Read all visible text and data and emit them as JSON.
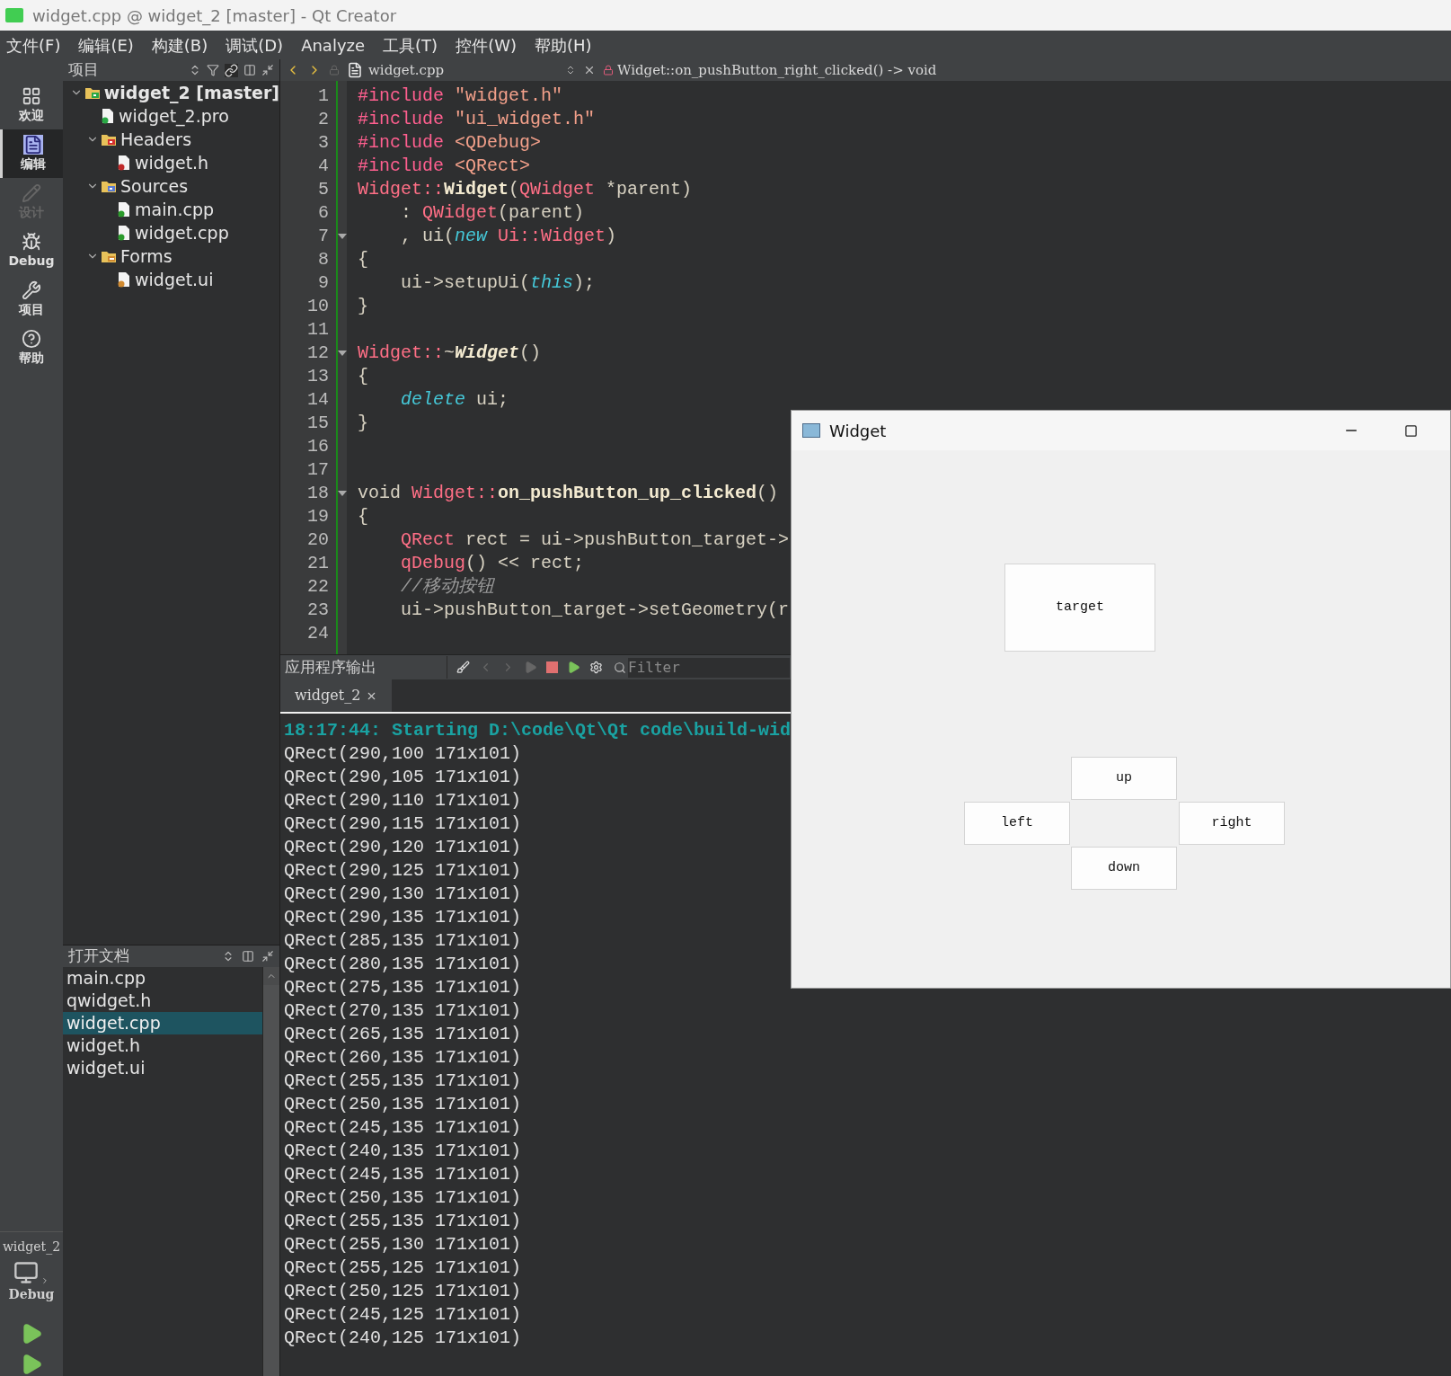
{
  "window": {
    "title": "widget.cpp @ widget_2 [master] - Qt Creator"
  },
  "menu": [
    {
      "label": "文件(F)"
    },
    {
      "label": "编辑(E)"
    },
    {
      "label": "构建(B)"
    },
    {
      "label": "调试(D)"
    },
    {
      "label": "Analyze"
    },
    {
      "label": "工具(T)"
    },
    {
      "label": "控件(W)"
    },
    {
      "label": "帮助(H)"
    }
  ],
  "mode_bar": [
    {
      "kind": "grid",
      "label": "欢迎",
      "selected": false,
      "disabled": false
    },
    {
      "kind": "doc",
      "label": "编辑",
      "selected": true,
      "disabled": false
    },
    {
      "kind": "pencil",
      "label": "设计",
      "selected": false,
      "disabled": true
    },
    {
      "kind": "bug",
      "label": "Debug",
      "selected": false,
      "disabled": false
    },
    {
      "kind": "wrench",
      "label": "项目",
      "selected": false,
      "disabled": false
    },
    {
      "kind": "help",
      "label": "帮助",
      "selected": false,
      "disabled": false
    }
  ],
  "kit": {
    "project": "widget_2",
    "build": "Debug"
  },
  "project_pane": {
    "title": "项目",
    "tree": [
      {
        "kind": "project",
        "label": "widget_2 [master]",
        "expanded": true,
        "children": [
          {
            "kind": "pro",
            "label": "widget_2.pro"
          },
          {
            "kind": "folder-h",
            "label": "Headers",
            "expanded": true,
            "children": [
              {
                "kind": "file-h",
                "label": "widget.h"
              }
            ]
          },
          {
            "kind": "folder-src",
            "label": "Sources",
            "expanded": true,
            "children": [
              {
                "kind": "file-cpp",
                "label": "main.cpp"
              },
              {
                "kind": "file-cpp",
                "label": "widget.cpp"
              }
            ]
          },
          {
            "kind": "folder-forms",
            "label": "Forms",
            "expanded": true,
            "children": [
              {
                "kind": "file-ui",
                "label": "widget.ui"
              }
            ]
          }
        ]
      }
    ]
  },
  "open_documents": {
    "title": "打开文档",
    "items": [
      {
        "label": "main.cpp",
        "selected": false
      },
      {
        "label": "qwidget.h",
        "selected": false
      },
      {
        "label": "widget.cpp",
        "selected": true
      },
      {
        "label": "widget.h",
        "selected": false
      },
      {
        "label": "widget.ui",
        "selected": false
      }
    ]
  },
  "editor": {
    "file": "widget.cpp",
    "symbol": "Widget::on_pushButton_right_clicked() -> void",
    "lines": [
      {
        "number": "1",
        "foldable": false,
        "tokens": [
          {
            "kind": "pp",
            "text": "#include"
          },
          {
            "kind": "str",
            "text": " \"widget.h\""
          }
        ]
      },
      {
        "number": "2",
        "foldable": false,
        "tokens": [
          {
            "kind": "pp",
            "text": "#include"
          },
          {
            "kind": "str",
            "text": " \"ui_widget.h\""
          }
        ]
      },
      {
        "number": "3",
        "foldable": false,
        "tokens": [
          {
            "kind": "pp",
            "text": "#include"
          },
          {
            "kind": "str",
            "text": " <QDebug>"
          }
        ]
      },
      {
        "number": "4",
        "foldable": false,
        "tokens": [
          {
            "kind": "pp",
            "text": "#include"
          },
          {
            "kind": "str",
            "text": " <QRect>"
          }
        ]
      },
      {
        "number": "5",
        "foldable": false,
        "tokens": [
          {
            "kind": "type",
            "text": "Widget::"
          },
          {
            "kind": "func",
            "text": "Widget"
          },
          {
            "kind": "plain",
            "text": "("
          },
          {
            "kind": "type",
            "text": "QWidget"
          },
          {
            "kind": "plain",
            "text": " *parent)"
          }
        ]
      },
      {
        "number": "6",
        "foldable": false,
        "tokens": [
          {
            "kind": "plain",
            "text": "    : "
          },
          {
            "kind": "type",
            "text": "QWidget"
          },
          {
            "kind": "plain",
            "text": "(parent)"
          }
        ]
      },
      {
        "number": "7",
        "foldable": true,
        "tokens": [
          {
            "kind": "plain",
            "text": "    , ui("
          },
          {
            "kind": "kw",
            "text": "new"
          },
          {
            "kind": "type",
            "text": " Ui::Widget"
          },
          {
            "kind": "plain",
            "text": ")"
          }
        ]
      },
      {
        "number": "8",
        "foldable": false,
        "tokens": [
          {
            "kind": "plain",
            "text": "{"
          }
        ]
      },
      {
        "number": "9",
        "foldable": false,
        "tokens": [
          {
            "kind": "plain",
            "text": "    ui->setupUi("
          },
          {
            "kind": "kw",
            "text": "this"
          },
          {
            "kind": "plain",
            "text": ");"
          }
        ]
      },
      {
        "number": "10",
        "foldable": false,
        "tokens": [
          {
            "kind": "plain",
            "text": "}"
          }
        ]
      },
      {
        "number": "11",
        "foldable": false
      },
      {
        "number": "12",
        "foldable": true,
        "tokens": [
          {
            "kind": "type",
            "text": "Widget::"
          },
          {
            "kind": "plain",
            "text": "~"
          },
          {
            "kind": "funcital",
            "text": "Widget"
          },
          {
            "kind": "plain",
            "text": "()"
          }
        ]
      },
      {
        "number": "13",
        "foldable": false,
        "tokens": [
          {
            "kind": "plain",
            "text": "{"
          }
        ]
      },
      {
        "number": "14",
        "foldable": false,
        "tokens": [
          {
            "kind": "kw",
            "text": "    delete"
          },
          {
            "kind": "plain",
            "text": " ui;"
          }
        ]
      },
      {
        "number": "15",
        "foldable": false,
        "tokens": [
          {
            "kind": "plain",
            "text": "}"
          }
        ]
      },
      {
        "number": "16",
        "foldable": false
      },
      {
        "number": "17",
        "foldable": false
      },
      {
        "number": "18",
        "foldable": true,
        "tokens": [
          {
            "kind": "plain",
            "text": "void "
          },
          {
            "kind": "type",
            "text": "Widget::"
          },
          {
            "kind": "func",
            "text": "on_pushButton_up_clicked"
          },
          {
            "kind": "plain",
            "text": "()"
          }
        ]
      },
      {
        "number": "19",
        "foldable": false,
        "tokens": [
          {
            "kind": "plain",
            "text": "{"
          }
        ]
      },
      {
        "number": "20",
        "foldable": false,
        "tokens": [
          {
            "kind": "type",
            "text": "    QRect"
          },
          {
            "kind": "plain",
            "text": " rect = ui->pushButton_target->"
          }
        ]
      },
      {
        "number": "21",
        "foldable": false,
        "tokens": [
          {
            "kind": "type",
            "text": "    qDebug"
          },
          {
            "kind": "plain",
            "text": "() << rect;"
          }
        ]
      },
      {
        "number": "22",
        "foldable": false,
        "tokens": [
          {
            "kind": "comment",
            "text": "    //移动按钮"
          }
        ]
      },
      {
        "number": "23",
        "foldable": false,
        "tokens": [
          {
            "kind": "plain",
            "text": "    ui->pushButton_target->setGeometry(r"
          }
        ]
      },
      {
        "number": "24",
        "foldable": false
      }
    ]
  },
  "output": {
    "title": "应用程序输出",
    "filter_placeholder": "Filter",
    "tabs": [
      {
        "label": "widget_2",
        "selected": true
      }
    ],
    "start_line": "18:17:44: Starting D:\\code\\Qt\\Qt code\\build-wid",
    "lines": [
      "QRect(290,100 171x101)",
      "QRect(290,105 171x101)",
      "QRect(290,110 171x101)",
      "QRect(290,115 171x101)",
      "QRect(290,120 171x101)",
      "QRect(290,125 171x101)",
      "QRect(290,130 171x101)",
      "QRect(290,135 171x101)",
      "QRect(285,135 171x101)",
      "QRect(280,135 171x101)",
      "QRect(275,135 171x101)",
      "QRect(270,135 171x101)",
      "QRect(265,135 171x101)",
      "QRect(260,135 171x101)",
      "QRect(255,135 171x101)",
      "QRect(250,135 171x101)",
      "QRect(245,135 171x101)",
      "QRect(240,135 171x101)",
      "QRect(245,135 171x101)",
      "QRect(250,135 171x101)",
      "QRect(255,135 171x101)",
      "QRect(255,130 171x101)",
      "QRect(255,125 171x101)",
      "QRect(250,125 171x101)",
      "QRect(245,125 171x101)",
      "QRect(240,125 171x101)"
    ]
  },
  "widget_window": {
    "title": "Widget",
    "buttons": [
      {
        "label": "target"
      },
      {
        "label": "up"
      },
      {
        "label": "left"
      },
      {
        "label": "right"
      },
      {
        "label": "down"
      }
    ]
  }
}
